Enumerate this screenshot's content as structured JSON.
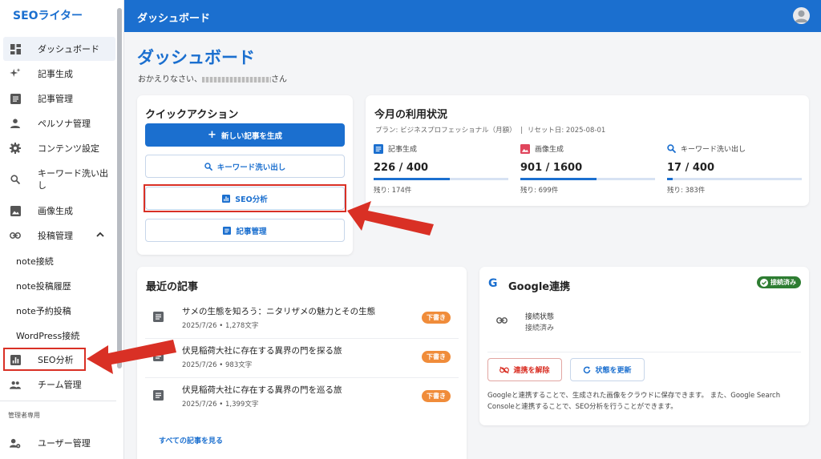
{
  "app": {
    "brand": "SEOライター",
    "header_title": "ダッシュボード"
  },
  "sidebar": {
    "items": [
      {
        "label": "ダッシュボード",
        "icon": "dashboard-icon"
      },
      {
        "label": "記事生成",
        "icon": "sparkle-icon"
      },
      {
        "label": "記事管理",
        "icon": "article-icon"
      },
      {
        "label": "ペルソナ管理",
        "icon": "person-icon"
      },
      {
        "label": "コンテンツ設定",
        "icon": "gear-icon"
      },
      {
        "label": "キーワード洗い出し",
        "icon": "search-icon"
      },
      {
        "label": "画像生成",
        "icon": "image-icon"
      },
      {
        "label": "投稿管理",
        "icon": "link-icon"
      }
    ],
    "sub_items": [
      "note接続",
      "note投稿履歴",
      "note予約投稿",
      "WordPress接続"
    ],
    "seo_item": {
      "label": "SEO分析",
      "icon": "analytics-icon"
    },
    "team_item": {
      "label": "チーム管理",
      "icon": "group-icon"
    },
    "admin_section": "管理者専用",
    "admin_item": {
      "label": "ユーザー管理",
      "icon": "user-settings-icon"
    }
  },
  "main": {
    "title": "ダッシュボード",
    "welcome_prefix": "おかえりなさい、",
    "welcome_suffix": "さん",
    "quick_actions": {
      "title": "クイックアクション",
      "buttons": [
        "新しい記事を生成",
        "キーワード洗い出し",
        "SEO分析",
        "記事管理"
      ]
    },
    "usage": {
      "title": "今月の利用状況",
      "plan": "プラン: ビジネスプロフェッショナル（月額）",
      "reset": "リセット日: 2025-08-01",
      "items": [
        {
          "label": "記事生成",
          "value": "226 / 400",
          "fraction": 0.565,
          "left": "残り: 174件",
          "icon_color": "#1b6fcf"
        },
        {
          "label": "画像生成",
          "value": "901 / 1600",
          "fraction": 0.563,
          "left": "残り: 699件",
          "icon_color": "#e0455c"
        },
        {
          "label": "キーワード洗い出し",
          "value": "17 / 400",
          "fraction": 0.043,
          "left": "残り: 383件",
          "icon_color": "#1b6fcf"
        }
      ]
    },
    "recent": {
      "title": "最近の記事",
      "articles": [
        {
          "title": "サメの生態を知ろう：ニタリザメの魅力とその生態",
          "meta": "2025/7/26 • 1,278文字",
          "status": "下書き"
        },
        {
          "title": "伏見稲荷大社に存在する異界の門を探る旅",
          "meta": "2025/7/26 • 983文字",
          "status": "下書き"
        },
        {
          "title": "伏見稲荷大社に存在する異界の門を巡る旅",
          "meta": "2025/7/26 • 1,399文字",
          "status": "下書き"
        }
      ],
      "view_all": "すべての記事を見る"
    },
    "google": {
      "title": "Google連携",
      "badge": "接続済み",
      "conn_label": "接続状態",
      "conn_value": "接続済み",
      "disconnect": "連携を解除",
      "refresh": "状態を更新",
      "description": "Googleと連携することで、生成された画像をクラウドに保存できます。 また、Google Search Consoleと連携することで、SEO分析を行うことができます。"
    }
  },
  "colors": {
    "primary": "#1b6fcf",
    "annotation": "#d93025",
    "draft": "#f08c3a",
    "connected": "#2e7d32"
  }
}
